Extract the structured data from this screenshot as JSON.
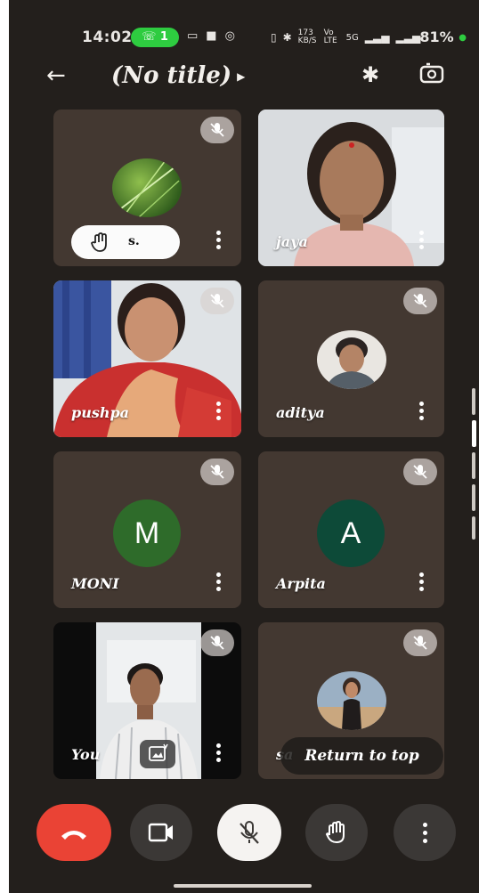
{
  "status_bar": {
    "time": "14:02",
    "call_indicator": "1",
    "left_icons": [
      "video-record-icon",
      "message-icon",
      "instagram-icon"
    ],
    "network": {
      "vibrate": "vibrate-icon",
      "bluetooth": "bluetooth-icon",
      "speed": "173 KB/S",
      "volte": "Vo LTE",
      "signal_5g": "5G",
      "signal": "signal-icon"
    },
    "battery": "81%"
  },
  "top_bar": {
    "title": "(No title)",
    "back_icon": "arrow-left-icon",
    "bluetooth_icon": "bluetooth-icon",
    "switch_camera_icon": "switch-camera-icon"
  },
  "participants": [
    {
      "id": "s",
      "chip_name": "s.",
      "raised_hand": true,
      "muted": true,
      "avatar": "photo-grass"
    },
    {
      "id": "jaya",
      "name": "jaya",
      "muted": false,
      "video": "camera-feed"
    },
    {
      "id": "pushpa",
      "name": "pushpa",
      "muted": true,
      "video": "camera-feed"
    },
    {
      "id": "aditya",
      "name": "aditya",
      "muted": true,
      "avatar": "photo-man"
    },
    {
      "id": "moni",
      "name": "MONI",
      "muted": true,
      "initial": "M",
      "color": "#2e6b2a"
    },
    {
      "id": "arpita",
      "name": "Arpita",
      "muted": true,
      "initial": "A",
      "color": "#0d4a38"
    },
    {
      "id": "you",
      "name": "You",
      "muted": true,
      "video": "camera-feed",
      "self": true
    },
    {
      "id": "sa",
      "name": "sa",
      "muted": true,
      "avatar": "photo-woman"
    }
  ],
  "return_to_top": "Return to top",
  "controls": {
    "end_call": "end-call-icon",
    "camera": "camera-icon",
    "mic": "mic-off-icon",
    "raise_hand": "raise-hand-icon",
    "more": "more-vert-icon"
  }
}
